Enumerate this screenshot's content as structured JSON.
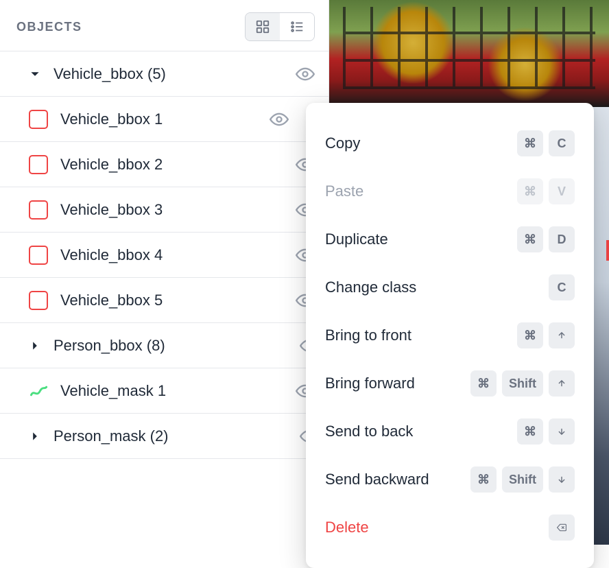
{
  "sidebar": {
    "title": "OBJECTS",
    "groups": [
      {
        "label": "Vehicle_bbox (5)",
        "expanded": true,
        "children_key": "vehicle_bbox"
      },
      {
        "label": "Person_bbox (8)",
        "expanded": false
      },
      {
        "label": "Vehicle_mask 1",
        "type": "mask"
      },
      {
        "label": "Person_mask (2)",
        "expanded": false
      }
    ],
    "vehicle_bbox": [
      {
        "label": "Vehicle_bbox 1"
      },
      {
        "label": "Vehicle_bbox 2"
      },
      {
        "label": "Vehicle_bbox 3"
      },
      {
        "label": "Vehicle_bbox 4"
      },
      {
        "label": "Vehicle_bbox 5"
      }
    ]
  },
  "menu": {
    "items": [
      {
        "label": "Copy",
        "keys": [
          "cmd",
          "C"
        ]
      },
      {
        "label": "Paste",
        "keys": [
          "cmd",
          "V"
        ],
        "disabled": true
      },
      {
        "label": "Duplicate",
        "keys": [
          "cmd",
          "D"
        ]
      },
      {
        "label": "Change class",
        "keys": [
          "C"
        ]
      },
      {
        "label": "Bring to front",
        "keys": [
          "cmd",
          "up"
        ]
      },
      {
        "label": "Bring forward",
        "keys": [
          "cmd",
          "Shift",
          "up"
        ]
      },
      {
        "label": "Send to back",
        "keys": [
          "cmd",
          "down"
        ]
      },
      {
        "label": "Send backward",
        "keys": [
          "cmd",
          "Shift",
          "down"
        ]
      },
      {
        "label": "Delete",
        "keys": [
          "backspace"
        ],
        "danger": true
      }
    ]
  },
  "icons": {
    "cmd": "⌘"
  }
}
